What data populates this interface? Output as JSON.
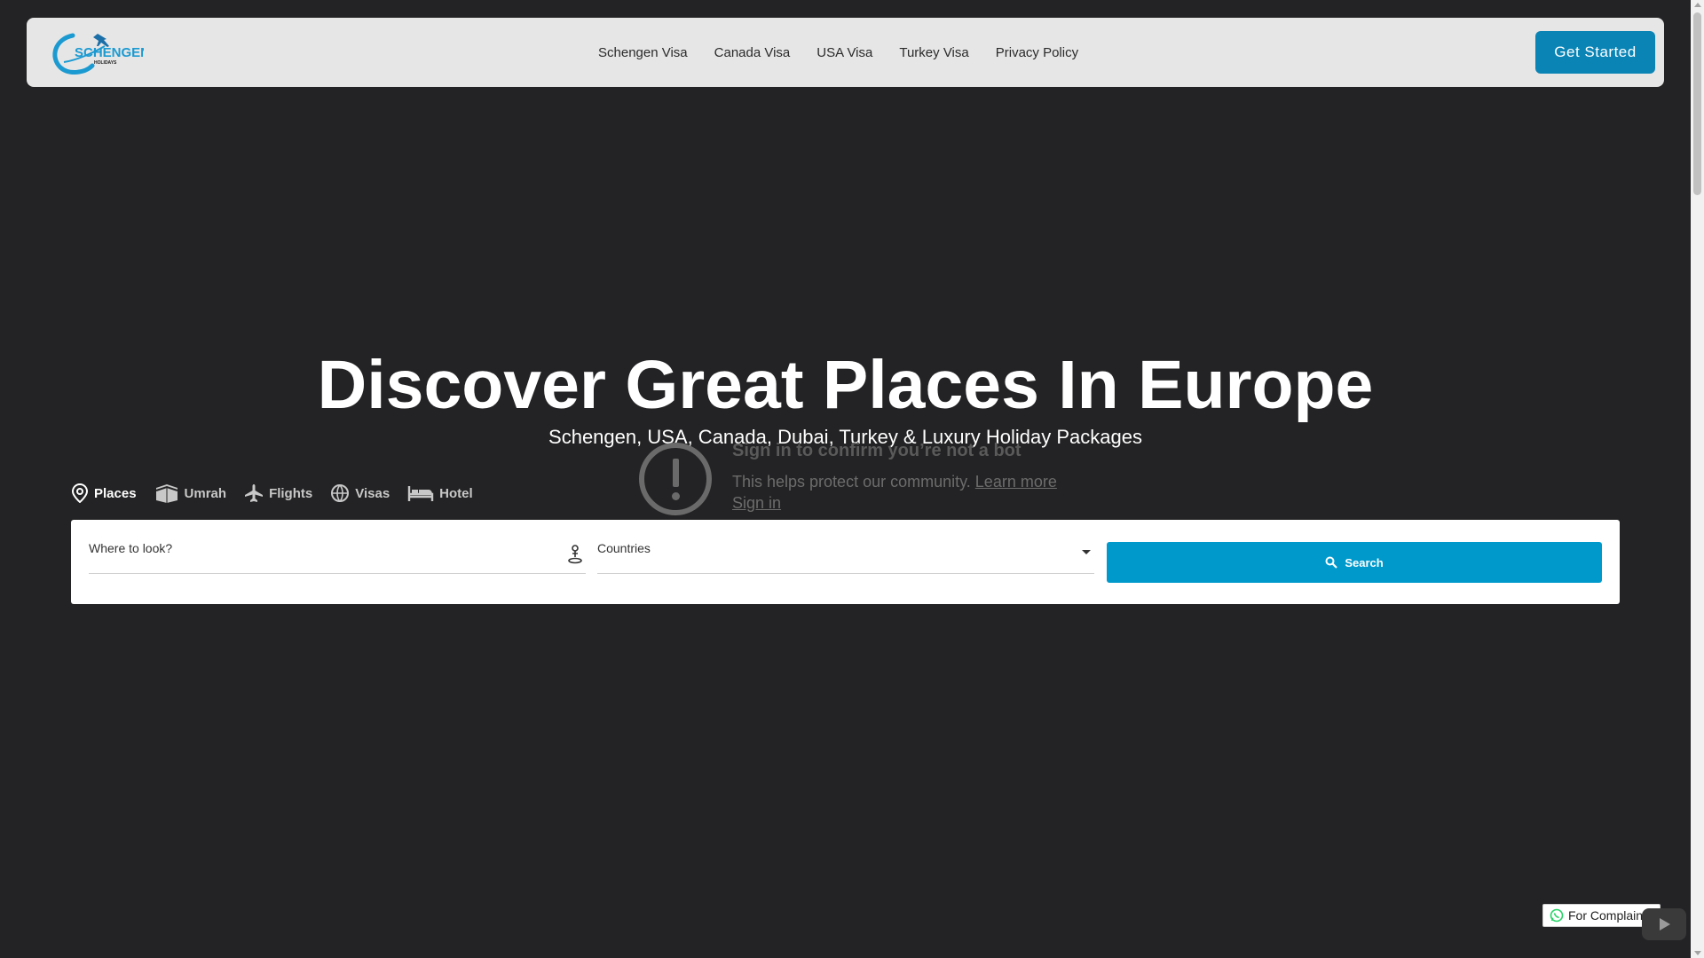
{
  "header": {
    "logo_text": "SCHENGEN",
    "logo_subtext": "HOLIDAYS",
    "nav": [
      "Schengen Visa",
      "Canada Visa",
      "USA Visa",
      "Turkey Visa",
      "Privacy Policy"
    ],
    "cta_label": "Get Started",
    "accent_color": "#0a84b5"
  },
  "hero": {
    "title": "Discover Great Places In Europe",
    "subtitle": "Schengen, USA, Canada, Dubai, Turkey & Luxury Holiday Packages"
  },
  "bot_notice": {
    "title": "Sign in to confirm you’re not a bot",
    "text": "This helps protect our community.",
    "learn_more": "Learn more",
    "sign_in": "Sign in",
    "icon": "alert-icon"
  },
  "tabs": [
    {
      "label": "Places",
      "icon": "map-pin-icon",
      "active": true
    },
    {
      "label": "Umrah",
      "icon": "kaaba-icon",
      "active": false
    },
    {
      "label": "Flights",
      "icon": "airplane-icon",
      "active": false
    },
    {
      "label": "Visas",
      "icon": "globe-icon",
      "active": false
    },
    {
      "label": "Hotel",
      "icon": "bed-icon",
      "active": false
    }
  ],
  "search": {
    "where_label": "Where to look?",
    "country_label": "Countries",
    "button_label": "Search",
    "button_color": "#0099cc"
  },
  "complaints": {
    "label": "For Complaints",
    "icon": "whatsapp-icon"
  }
}
